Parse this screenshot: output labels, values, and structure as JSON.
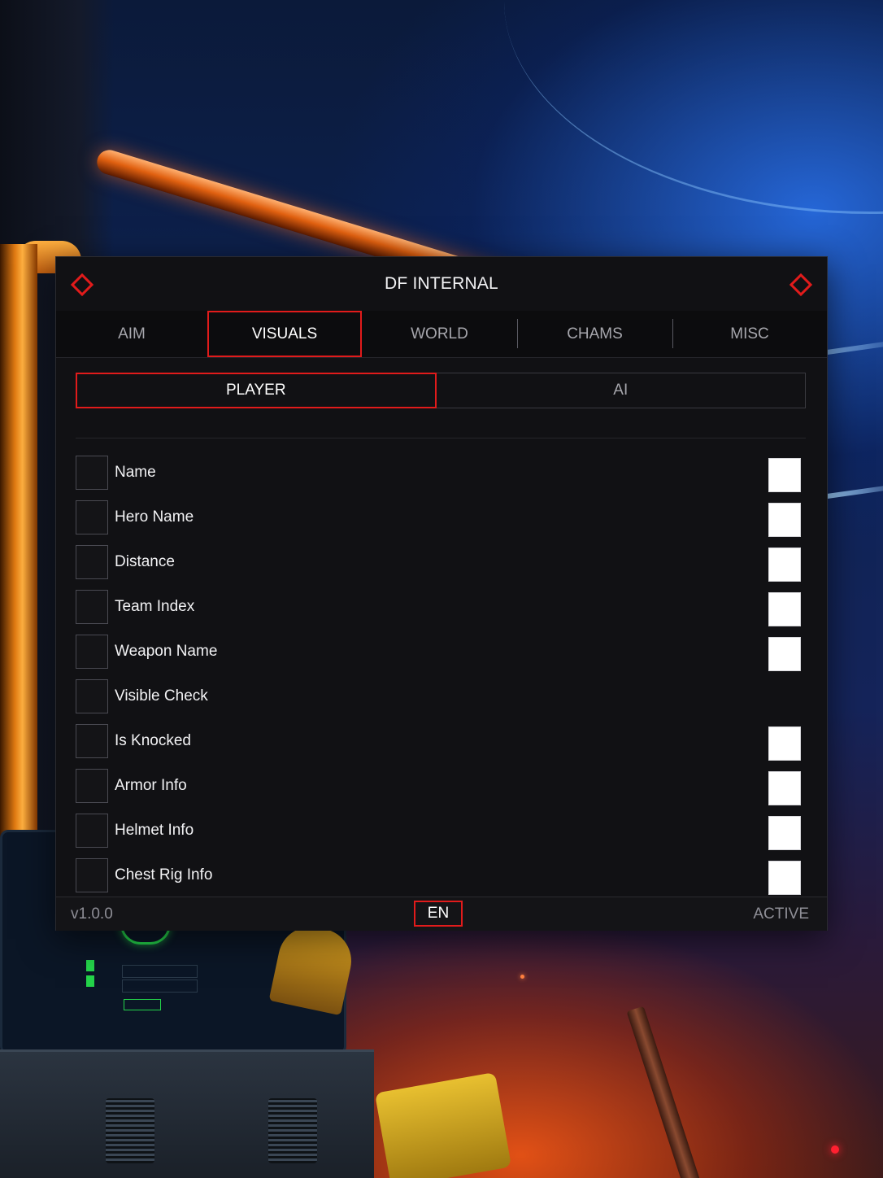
{
  "window": {
    "title": "DF INTERNAL"
  },
  "tabs": [
    {
      "label": "AIM",
      "active": false
    },
    {
      "label": "VISUALS",
      "active": true
    },
    {
      "label": "WORLD",
      "active": false
    },
    {
      "label": "CHAMS",
      "active": false
    },
    {
      "label": "MISC",
      "active": false
    }
  ],
  "subtabs": [
    {
      "label": "PLAYER",
      "active": true
    },
    {
      "label": "AI",
      "active": false
    }
  ],
  "options": [
    {
      "label": "Name",
      "checked": false,
      "has_color": true,
      "color": "#ffffff"
    },
    {
      "label": "Hero Name",
      "checked": false,
      "has_color": true,
      "color": "#ffffff"
    },
    {
      "label": "Distance",
      "checked": false,
      "has_color": true,
      "color": "#ffffff"
    },
    {
      "label": "Team Index",
      "checked": false,
      "has_color": true,
      "color": "#ffffff"
    },
    {
      "label": "Weapon Name",
      "checked": false,
      "has_color": true,
      "color": "#ffffff"
    },
    {
      "label": "Visible Check",
      "checked": false,
      "has_color": false
    },
    {
      "label": "Is Knocked",
      "checked": false,
      "has_color": true,
      "color": "#ffffff"
    },
    {
      "label": "Armor Info",
      "checked": false,
      "has_color": true,
      "color": "#ffffff"
    },
    {
      "label": "Helmet Info",
      "checked": false,
      "has_color": true,
      "color": "#ffffff"
    },
    {
      "label": "Chest Rig Info",
      "checked": false,
      "has_color": true,
      "color": "#ffffff"
    }
  ],
  "footer": {
    "version": "v1.0.0",
    "language": "EN",
    "status": "ACTIVE"
  },
  "colors": {
    "accent": "#e11b1b",
    "panel_bg": "#111114"
  }
}
